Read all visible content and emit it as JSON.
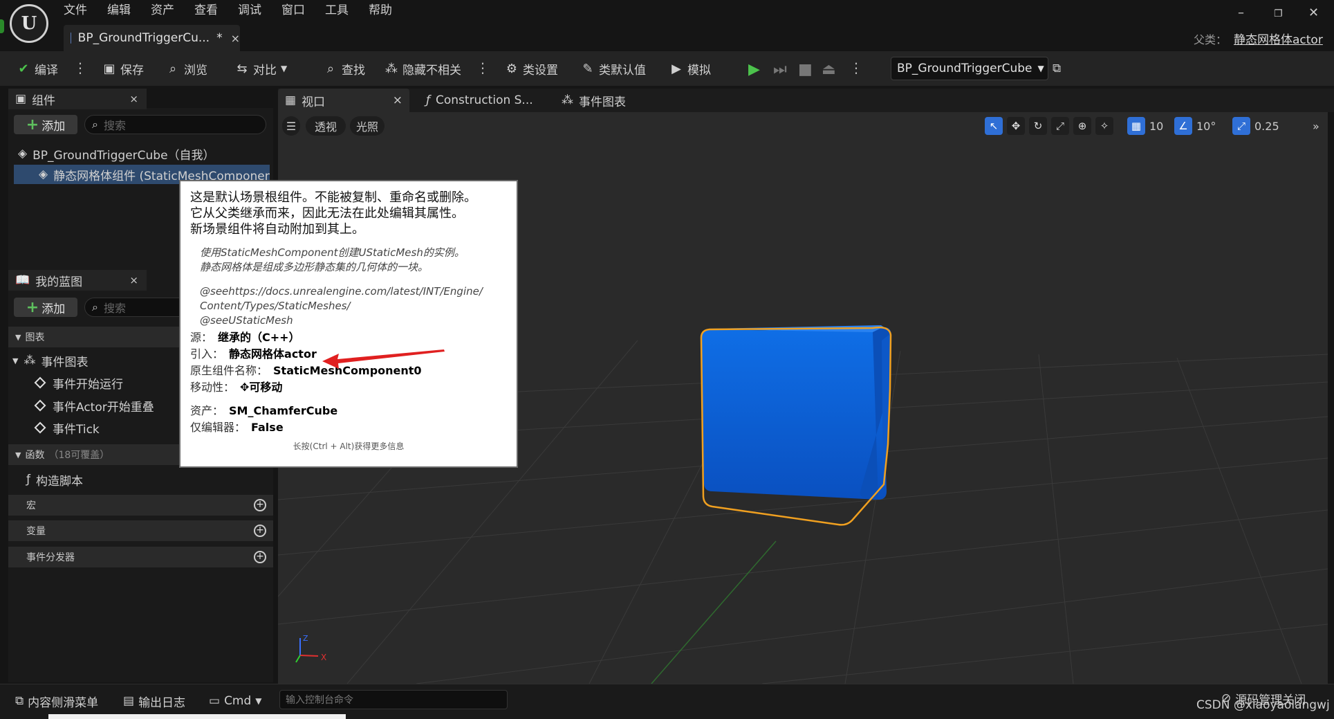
{
  "menu": [
    "文件",
    "编辑",
    "资产",
    "查看",
    "调试",
    "窗口",
    "工具",
    "帮助"
  ],
  "doc_tab": {
    "title": "BP_GroundTriggerCu...",
    "modified": "*",
    "close": "×"
  },
  "window_controls": {
    "min": "–",
    "restore": "❐",
    "close": "✕"
  },
  "parent": {
    "label": "父类：",
    "value": "静态网格体actor"
  },
  "toolbar": {
    "compile": "编译",
    "save": "保存",
    "browse": "浏览",
    "diff": "对比",
    "find": "查找",
    "hide_unrelated": "隐藏不相关",
    "class_settings": "类设置",
    "class_defaults": "类默认值",
    "simulate": "模拟",
    "blueprint_select": "BP_GroundTriggerCube"
  },
  "components_panel": {
    "title": "组件",
    "add": "添加",
    "search_placeholder": "搜索",
    "root_item": "BP_GroundTriggerCube（自我）",
    "child_item": "静态网格体组件 (StaticMeshComponent"
  },
  "my_blueprint": {
    "title": "我的蓝图",
    "add": "添加",
    "search_placeholder": "搜索",
    "graphs_section": "图表",
    "event_graph": "事件图表",
    "events": [
      "事件开始运行",
      "事件Actor开始重叠",
      "事件Tick"
    ],
    "functions_section": "函数",
    "functions_override": "（18可覆盖）",
    "construction_script": "构造脚本",
    "macros": "宏",
    "variables": "变量",
    "event_dispatchers": "事件分发器"
  },
  "viewport_tabs": {
    "viewport": "视口",
    "construction": "Construction S...",
    "event_graph": "事件图表"
  },
  "viewport": {
    "perspective": "透视",
    "lighting": "光照",
    "grid_snap": "10",
    "rotation_snap": "10°",
    "scale_snap": "0.25"
  },
  "tooltip": {
    "main": "这是默认场景根组件。不能被复制、重命名或删除。\n它从父类继承而来，因此无法在此处编辑其属性。\n新场景组件将自动附加到其上。",
    "doc1": "使用StaticMeshComponent创建UStaticMesh的实例。\n静态网格体是组成多边形静态集的几何体的一块。",
    "doc2": "@seehttps://docs.unrealengine.com/latest/INT/Engine/\nContent/Types/StaticMeshes/\n@seeUStaticMesh",
    "source_label": "源：",
    "source_value": "继承的（C++）",
    "introduced_label": "引入：",
    "introduced_value": "静态网格体actor",
    "native_name_label": "原生组件名称：",
    "native_name_value": "StaticMeshComponent0",
    "mobility_label": "移动性：",
    "mobility_value": "可移动",
    "asset_label": "资产：",
    "asset_value": "SM_ChamferCube",
    "editor_only_label": "仅编辑器：",
    "editor_only_value": "False",
    "hint": "长按(Ctrl + Alt)获得更多信息"
  },
  "statusbar": {
    "content_drawer": "内容侧滑菜单",
    "output_log": "输出日志",
    "cmd": "Cmd",
    "cmd_placeholder": "输入控制台命令",
    "source_control": "源码管理关闭"
  },
  "watermark": "CSDN @xiaoyaolangwj",
  "colors": {
    "accent_blue": "#2f6fd6",
    "cube_blue": "#0a5fd8",
    "selection_outline": "#f0a020",
    "arrow_red": "#e02020",
    "play_green": "#4cc24c"
  }
}
